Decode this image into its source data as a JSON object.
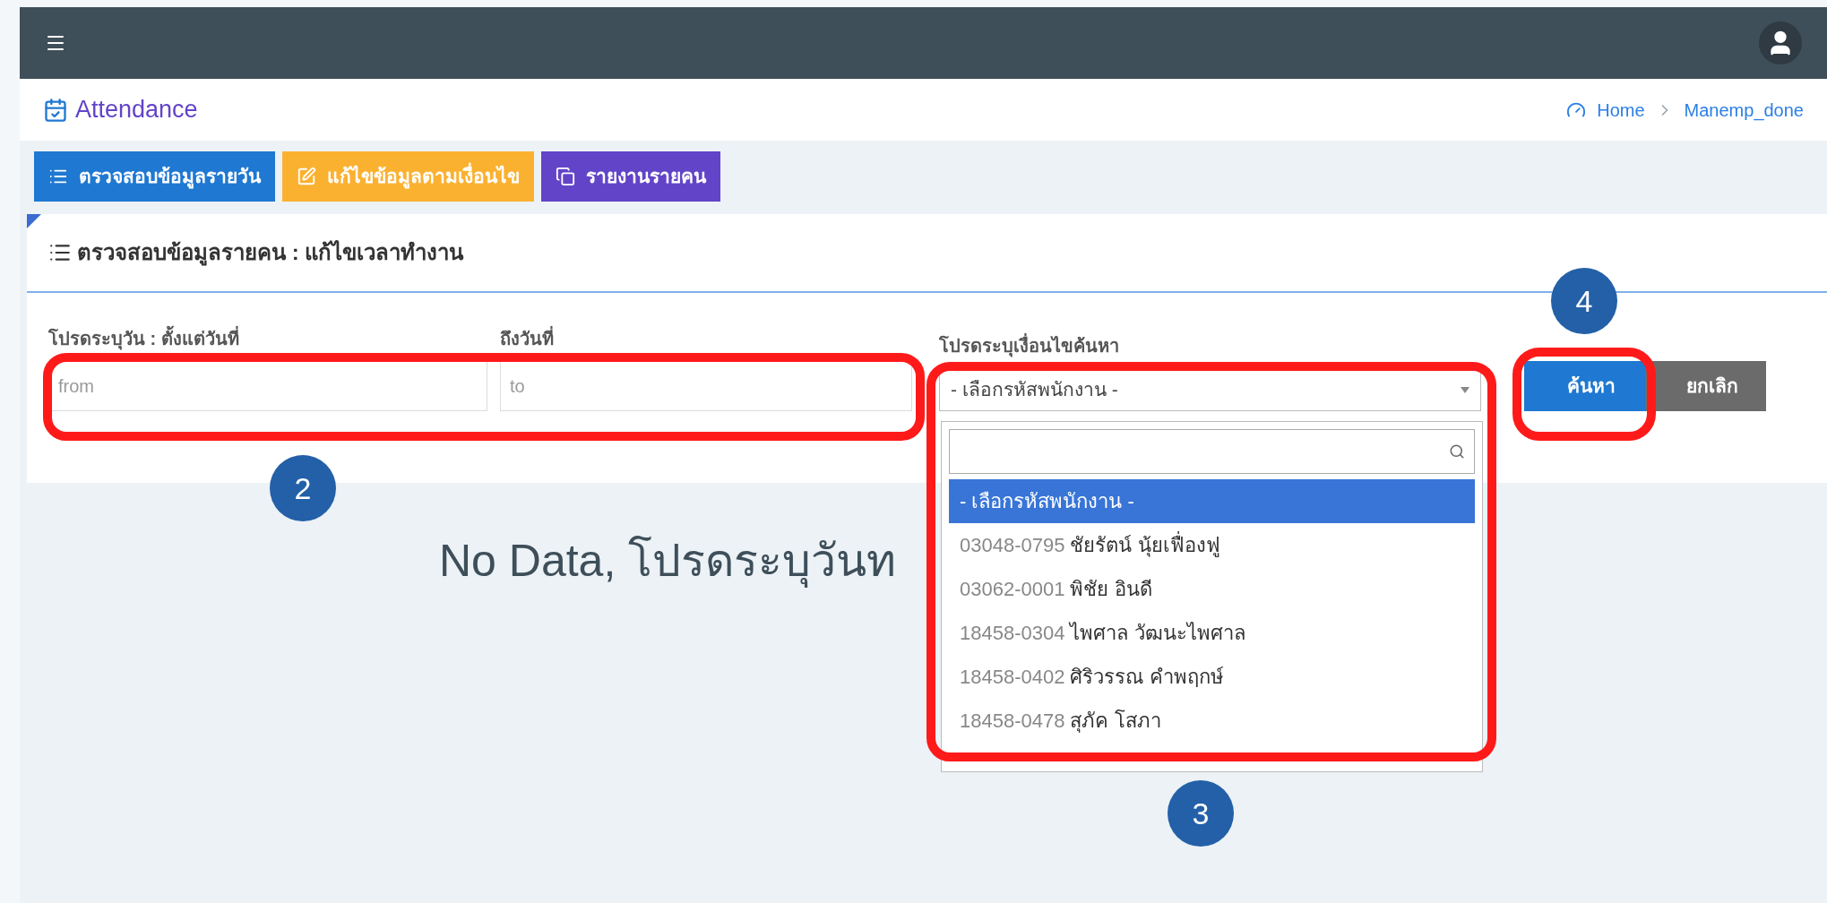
{
  "header": {
    "title": "Attendance",
    "breadcrumb": [
      "Home",
      "Manemp_done"
    ]
  },
  "tabs": [
    {
      "label": "ตรวจสอบข้อมูลรายวัน",
      "color": "#1f78d1",
      "kind": "list"
    },
    {
      "label": "แก้ไขข้อมูลตามเงื่อนไข",
      "color": "#fbb130",
      "kind": "edit"
    },
    {
      "label": "รายงานรายคน",
      "color": "#6244c8",
      "kind": "copy"
    }
  ],
  "card": {
    "title": "ตรวจสอบข้อมูลรายคน : แก้ไขเวลาทำงาน",
    "from": {
      "label": "โปรดระบุวัน : ตั้งแต่วันที่",
      "placeholder": "from"
    },
    "to": {
      "label": "ถึงวันที่",
      "placeholder": "to"
    },
    "criteria": {
      "label": "โปรดระบุเงื่อนไขค้นหา",
      "value": "- เลือกรหัสพนักงาน -",
      "expanded": true
    },
    "buttons": [
      {
        "label": "ค้นหา",
        "kind": "primary"
      },
      {
        "label": "ยกเลิก",
        "kind": "secondary"
      }
    ]
  },
  "dropdown": {
    "options": [
      {
        "name": "- เลือกรหัสพนักงาน -",
        "selected": true
      },
      {
        "code": "03048-0795",
        "name": "ชัยรัตน์ นุ้ยเฟื่องฟู",
        "selected": false
      },
      {
        "code": "03062-0001",
        "name": "พิชัย อินดี",
        "selected": false
      },
      {
        "code": "18458-0304",
        "name": "ไพศาล วัฒนะไพศาล",
        "selected": false
      },
      {
        "code": "18458-0402",
        "name": "ศิริวรรณ คำพฤกษ์",
        "selected": false
      },
      {
        "code": "18458-0478",
        "name": "สุภัค โสภา",
        "selected": false
      }
    ]
  },
  "message": "No Data, โปรดระบุวันท",
  "steps": [
    "2",
    "3",
    "4"
  ]
}
